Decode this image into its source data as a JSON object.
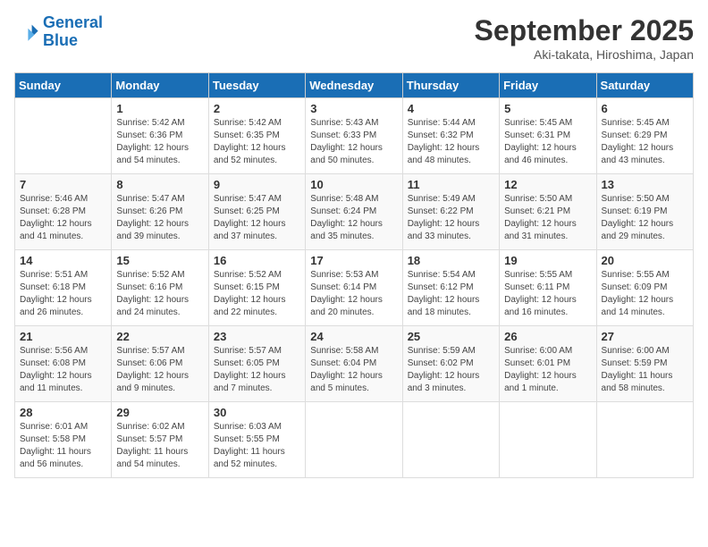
{
  "header": {
    "logo_line1": "General",
    "logo_line2": "Blue",
    "month": "September 2025",
    "location": "Aki-takata, Hiroshima, Japan"
  },
  "weekdays": [
    "Sunday",
    "Monday",
    "Tuesday",
    "Wednesday",
    "Thursday",
    "Friday",
    "Saturday"
  ],
  "weeks": [
    [
      null,
      {
        "day": "1",
        "sunrise": "Sunrise: 5:42 AM",
        "sunset": "Sunset: 6:36 PM",
        "daylight": "Daylight: 12 hours and 54 minutes."
      },
      {
        "day": "2",
        "sunrise": "Sunrise: 5:42 AM",
        "sunset": "Sunset: 6:35 PM",
        "daylight": "Daylight: 12 hours and 52 minutes."
      },
      {
        "day": "3",
        "sunrise": "Sunrise: 5:43 AM",
        "sunset": "Sunset: 6:33 PM",
        "daylight": "Daylight: 12 hours and 50 minutes."
      },
      {
        "day": "4",
        "sunrise": "Sunrise: 5:44 AM",
        "sunset": "Sunset: 6:32 PM",
        "daylight": "Daylight: 12 hours and 48 minutes."
      },
      {
        "day": "5",
        "sunrise": "Sunrise: 5:45 AM",
        "sunset": "Sunset: 6:31 PM",
        "daylight": "Daylight: 12 hours and 46 minutes."
      },
      {
        "day": "6",
        "sunrise": "Sunrise: 5:45 AM",
        "sunset": "Sunset: 6:29 PM",
        "daylight": "Daylight: 12 hours and 43 minutes."
      }
    ],
    [
      {
        "day": "7",
        "sunrise": "Sunrise: 5:46 AM",
        "sunset": "Sunset: 6:28 PM",
        "daylight": "Daylight: 12 hours and 41 minutes."
      },
      {
        "day": "8",
        "sunrise": "Sunrise: 5:47 AM",
        "sunset": "Sunset: 6:26 PM",
        "daylight": "Daylight: 12 hours and 39 minutes."
      },
      {
        "day": "9",
        "sunrise": "Sunrise: 5:47 AM",
        "sunset": "Sunset: 6:25 PM",
        "daylight": "Daylight: 12 hours and 37 minutes."
      },
      {
        "day": "10",
        "sunrise": "Sunrise: 5:48 AM",
        "sunset": "Sunset: 6:24 PM",
        "daylight": "Daylight: 12 hours and 35 minutes."
      },
      {
        "day": "11",
        "sunrise": "Sunrise: 5:49 AM",
        "sunset": "Sunset: 6:22 PM",
        "daylight": "Daylight: 12 hours and 33 minutes."
      },
      {
        "day": "12",
        "sunrise": "Sunrise: 5:50 AM",
        "sunset": "Sunset: 6:21 PM",
        "daylight": "Daylight: 12 hours and 31 minutes."
      },
      {
        "day": "13",
        "sunrise": "Sunrise: 5:50 AM",
        "sunset": "Sunset: 6:19 PM",
        "daylight": "Daylight: 12 hours and 29 minutes."
      }
    ],
    [
      {
        "day": "14",
        "sunrise": "Sunrise: 5:51 AM",
        "sunset": "Sunset: 6:18 PM",
        "daylight": "Daylight: 12 hours and 26 minutes."
      },
      {
        "day": "15",
        "sunrise": "Sunrise: 5:52 AM",
        "sunset": "Sunset: 6:16 PM",
        "daylight": "Daylight: 12 hours and 24 minutes."
      },
      {
        "day": "16",
        "sunrise": "Sunrise: 5:52 AM",
        "sunset": "Sunset: 6:15 PM",
        "daylight": "Daylight: 12 hours and 22 minutes."
      },
      {
        "day": "17",
        "sunrise": "Sunrise: 5:53 AM",
        "sunset": "Sunset: 6:14 PM",
        "daylight": "Daylight: 12 hours and 20 minutes."
      },
      {
        "day": "18",
        "sunrise": "Sunrise: 5:54 AM",
        "sunset": "Sunset: 6:12 PM",
        "daylight": "Daylight: 12 hours and 18 minutes."
      },
      {
        "day": "19",
        "sunrise": "Sunrise: 5:55 AM",
        "sunset": "Sunset: 6:11 PM",
        "daylight": "Daylight: 12 hours and 16 minutes."
      },
      {
        "day": "20",
        "sunrise": "Sunrise: 5:55 AM",
        "sunset": "Sunset: 6:09 PM",
        "daylight": "Daylight: 12 hours and 14 minutes."
      }
    ],
    [
      {
        "day": "21",
        "sunrise": "Sunrise: 5:56 AM",
        "sunset": "Sunset: 6:08 PM",
        "daylight": "Daylight: 12 hours and 11 minutes."
      },
      {
        "day": "22",
        "sunrise": "Sunrise: 5:57 AM",
        "sunset": "Sunset: 6:06 PM",
        "daylight": "Daylight: 12 hours and 9 minutes."
      },
      {
        "day": "23",
        "sunrise": "Sunrise: 5:57 AM",
        "sunset": "Sunset: 6:05 PM",
        "daylight": "Daylight: 12 hours and 7 minutes."
      },
      {
        "day": "24",
        "sunrise": "Sunrise: 5:58 AM",
        "sunset": "Sunset: 6:04 PM",
        "daylight": "Daylight: 12 hours and 5 minutes."
      },
      {
        "day": "25",
        "sunrise": "Sunrise: 5:59 AM",
        "sunset": "Sunset: 6:02 PM",
        "daylight": "Daylight: 12 hours and 3 minutes."
      },
      {
        "day": "26",
        "sunrise": "Sunrise: 6:00 AM",
        "sunset": "Sunset: 6:01 PM",
        "daylight": "Daylight: 12 hours and 1 minute."
      },
      {
        "day": "27",
        "sunrise": "Sunrise: 6:00 AM",
        "sunset": "Sunset: 5:59 PM",
        "daylight": "Daylight: 11 hours and 58 minutes."
      }
    ],
    [
      {
        "day": "28",
        "sunrise": "Sunrise: 6:01 AM",
        "sunset": "Sunset: 5:58 PM",
        "daylight": "Daylight: 11 hours and 56 minutes."
      },
      {
        "day": "29",
        "sunrise": "Sunrise: 6:02 AM",
        "sunset": "Sunset: 5:57 PM",
        "daylight": "Daylight: 11 hours and 54 minutes."
      },
      {
        "day": "30",
        "sunrise": "Sunrise: 6:03 AM",
        "sunset": "Sunset: 5:55 PM",
        "daylight": "Daylight: 11 hours and 52 minutes."
      },
      null,
      null,
      null,
      null
    ]
  ]
}
